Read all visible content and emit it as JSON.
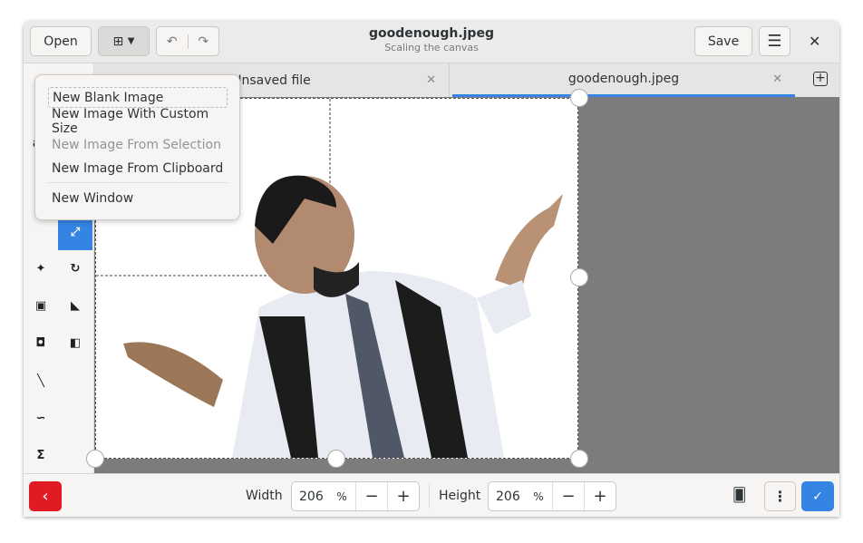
{
  "header": {
    "open_label": "Open",
    "title": "goodenough.jpeg",
    "subtitle": "Scaling the canvas",
    "save_label": "Save"
  },
  "tabs": [
    {
      "label": "Unsaved file"
    },
    {
      "label": "goodenough.jpeg",
      "active": true
    }
  ],
  "menu": {
    "items": [
      {
        "label": "New Blank Image",
        "enabled": true
      },
      {
        "label": "New Image With Custom Size",
        "enabled": true
      },
      {
        "label": "New Image From Selection",
        "enabled": false
      },
      {
        "label": "New Image From Clipboard",
        "enabled": true
      },
      {
        "label": "New Window",
        "enabled": true
      }
    ]
  },
  "tools": {
    "text_label": "ab",
    "active": "scale"
  },
  "bottom": {
    "width_label": "Width",
    "width_value": "206",
    "width_unit": "%",
    "height_label": "Height",
    "height_value": "206",
    "height_unit": "%"
  },
  "colors": {
    "accent": "#3584e4",
    "cancel": "#e01b24"
  }
}
